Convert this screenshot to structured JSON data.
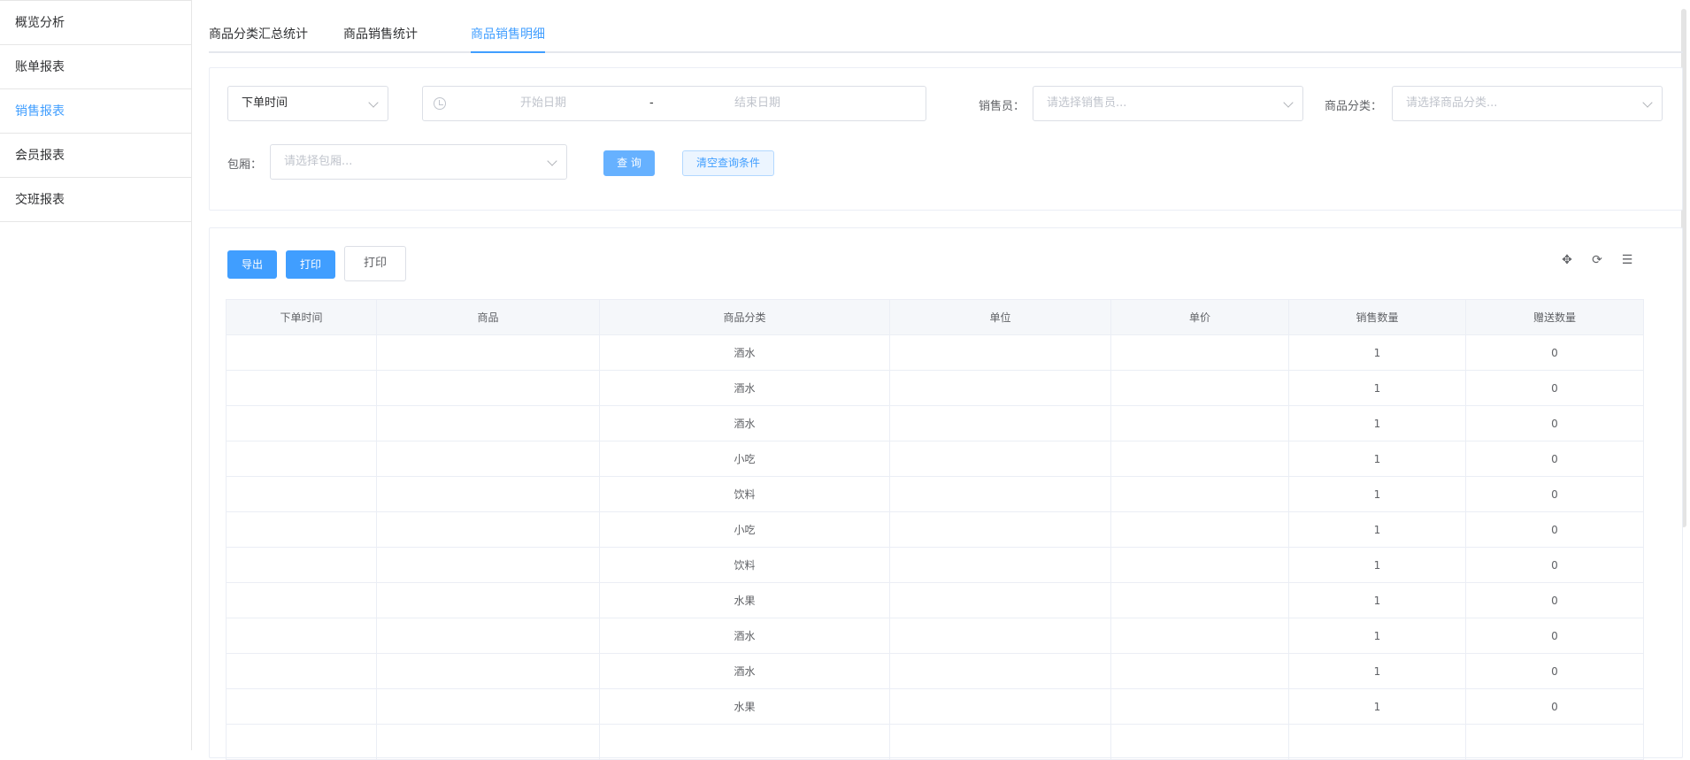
{
  "sidebar": {
    "items": [
      {
        "label": "概览分析",
        "active": false
      },
      {
        "label": "账单报表",
        "active": false
      },
      {
        "label": "销售报表",
        "active": true
      },
      {
        "label": "会员报表",
        "active": false
      },
      {
        "label": "交班报表",
        "active": false
      }
    ]
  },
  "tabs": [
    {
      "label": "商品分类汇总统计"
    },
    {
      "label": "商品销售统计"
    },
    {
      "label": "商品销售明细",
      "active": true
    }
  ],
  "filters": {
    "time_type": {
      "value": "下单时间"
    },
    "date_range": {
      "start_placeholder": "开始日期",
      "separator": "-",
      "end_placeholder": "结束日期"
    },
    "salesperson": {
      "label": "销售员：",
      "placeholder": "请选择销售员..."
    },
    "category": {
      "label": "商品分类：",
      "placeholder": "请选择商品分类..."
    },
    "room": {
      "label": "包厢：",
      "placeholder": "请选择包厢..."
    },
    "query_button": "查 询",
    "clear_button": "清空查询条件"
  },
  "toolbar": {
    "export_button": "导出",
    "print_button": "打印",
    "print_button2": "打印",
    "icons": [
      "move-icon",
      "refresh-icon",
      "settings-icon"
    ]
  },
  "table": {
    "headers": [
      "下单时间",
      "商品",
      "商品分类",
      "单位",
      "单价",
      "销售数量",
      "赠送数量"
    ],
    "rows": [
      [
        "",
        "",
        "酒水",
        "",
        "",
        "1",
        "0"
      ],
      [
        "",
        "",
        "酒水",
        "",
        "",
        "1",
        "0"
      ],
      [
        "",
        "",
        "酒水",
        "",
        "",
        "1",
        "0"
      ],
      [
        "",
        "",
        "小吃",
        "",
        "",
        "1",
        "0"
      ],
      [
        "",
        "",
        "饮料",
        "",
        "",
        "1",
        "0"
      ],
      [
        "",
        "",
        "小吃",
        "",
        "",
        "1",
        "0"
      ],
      [
        "",
        "",
        "饮料",
        "",
        "",
        "1",
        "0"
      ],
      [
        "",
        "",
        "水果",
        "",
        "",
        "1",
        "0"
      ],
      [
        "",
        "",
        "酒水",
        "",
        "",
        "1",
        "0"
      ],
      [
        "",
        "",
        "酒水",
        "",
        "",
        "1",
        "0"
      ],
      [
        "",
        "",
        "水果",
        "",
        "",
        "1",
        "0"
      ],
      [
        "",
        "",
        "",
        "",
        "",
        "",
        ""
      ]
    ]
  },
  "colors": {
    "accent": "#409eff",
    "border": "#ebeef5",
    "header_bg": "#f5f7fa"
  }
}
